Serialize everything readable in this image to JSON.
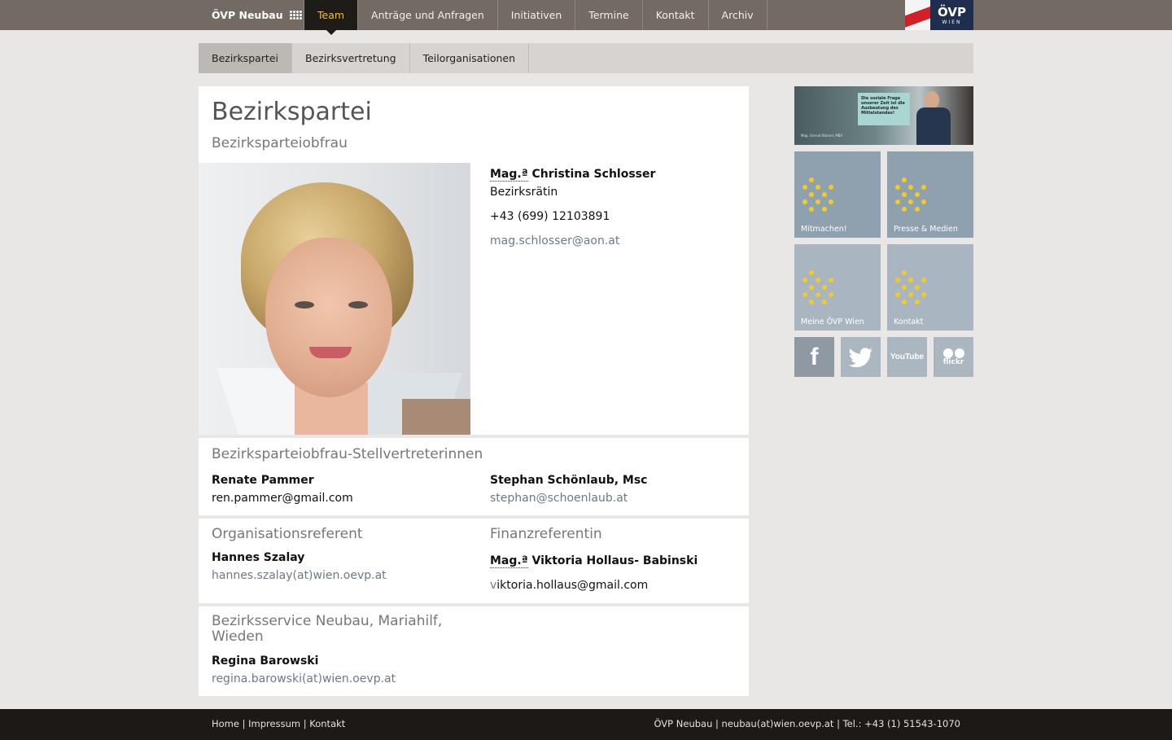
{
  "topbar": {
    "brand": "ÖVP Neubau",
    "nav": [
      "Team",
      "Anträge und Anfragen",
      "Initiativen",
      "Termine",
      "Kontakt",
      "Archiv"
    ],
    "logo": {
      "line1": "ÖVP",
      "line2": "WIEN"
    }
  },
  "subnav": [
    "Bezirkspartei",
    "Bezirksvertretung",
    "Teilorganisationen"
  ],
  "main": {
    "title": "Bezirkspartei",
    "obfrau": {
      "heading": "Bezirksparteiobfrau",
      "abbr": "Mag.ª",
      "name": "Christina Schlosser",
      "role": "Bezirksrätin",
      "phone": "+43 (699) 12103891",
      "email": "mag.schlosser@aon.at"
    },
    "stellvertreter": {
      "heading": "Bezirksparteiobfrau-Stellvertreterinnen",
      "people": [
        {
          "name": "Renate Pammer",
          "email": "ren.pammer@gmail.com"
        },
        {
          "name": "Stephan Schönlaub, Msc",
          "email": "stephan@schoenlaub.at"
        }
      ]
    },
    "orgref": {
      "heading": "Organisationsreferent",
      "name": "Hannes Szalay",
      "email": "hannes.szalay(at)wien.oevp.at"
    },
    "finanz": {
      "heading": "Finanzreferentin",
      "abbr": "Mag.ª",
      "name": "Viktoria Hollaus- Babinski",
      "email_first": "v",
      "email_rest": "iktoria.hollaus@gmail.com"
    },
    "service": {
      "heading_line1": "Bezirksservice Neubau, Mariahilf,",
      "heading_line2": "Wieden",
      "name": "Regina Barowski",
      "email": "regina.barowski(at)wien.oevp.at"
    }
  },
  "sidebar": {
    "banner": {
      "quote": "Die soziale Frage unserer Zeit ist die Ausbeutung des Mittelstandes!",
      "caption": "Mag. Gernot Blümel, MBA"
    },
    "tiles": [
      "Mitmachen!",
      "Presse & Medien",
      "Meine ÖVP Wien",
      "Kontakt"
    ],
    "social": [
      "f",
      "YouTube",
      "flickr"
    ]
  },
  "footer": {
    "links": [
      "Home",
      "Impressum",
      "Kontakt"
    ],
    "info": "ÖVP Neubau | neubau(at)wien.oevp.at | Tel.: +43 (1) 51543-1070"
  },
  "colors": {
    "topbar": "#726a63",
    "active_nav_text": "#f3c21b",
    "tile": "#8fa0ae",
    "tile_dots": "#f2cc1f",
    "link": "#6a7a8a"
  }
}
